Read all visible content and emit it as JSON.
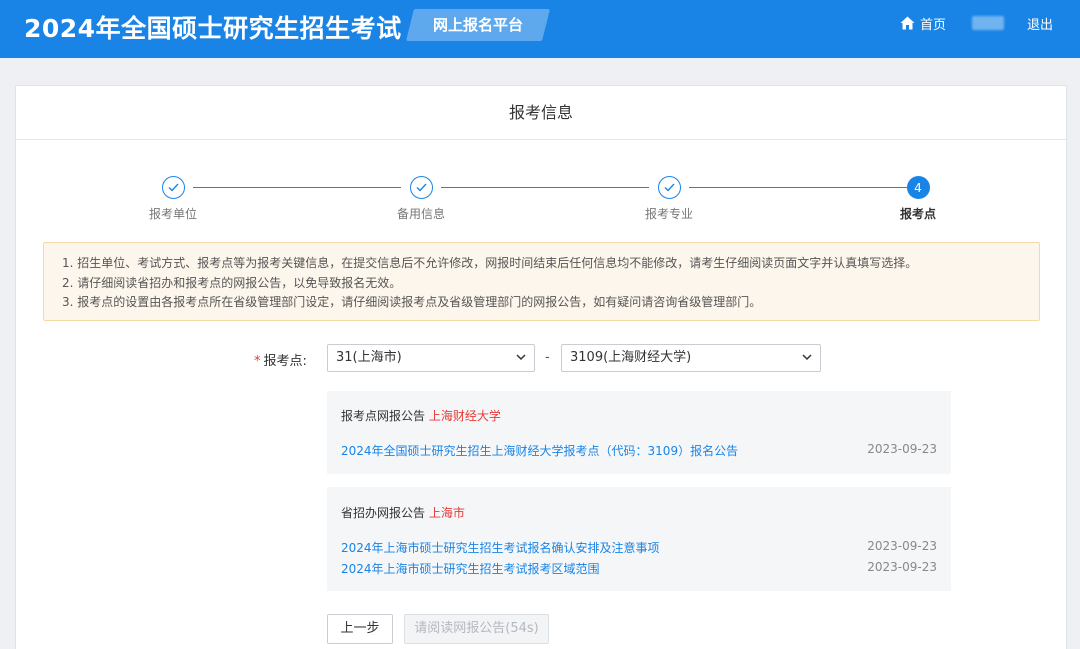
{
  "header": {
    "title": "2024年全国硕士研究生招生考试",
    "platform": "网上报名平台",
    "home_label": "首页",
    "logout_label": "退出"
  },
  "card": {
    "title": "报考信息"
  },
  "steps": [
    {
      "label": "报考单位",
      "status": "done"
    },
    {
      "label": "备用信息",
      "status": "done"
    },
    {
      "label": "报考专业",
      "status": "done"
    },
    {
      "label": "报考点",
      "status": "active",
      "number": "4"
    }
  ],
  "notice": [
    "1. 招生单位、考试方式、报考点等为报考关键信息，在提交信息后不允许修改，网报时间结束后任何信息均不能修改，请考生仔细阅读页面文字并认真填写选择。",
    "2. 请仔细阅读省招办和报考点的网报公告，以免导致报名无效。",
    "3. 报考点的设置由各报考点所在省级管理部门设定，请仔细阅读报考点及省级管理部门的网报公告，如有疑问请咨询省级管理部门。"
  ],
  "form": {
    "required_mark": "*",
    "label": "报考点:",
    "province_select": "31(上海市)",
    "separator": "-",
    "site_select": "3109(上海财经大学)"
  },
  "site_announcements": {
    "heading": "报考点网报公告",
    "heading_org": "上海财经大学",
    "items": [
      {
        "title": "2024年全国硕士研究生招生上海财经大学报考点（代码：3109）报名公告",
        "date": "2023-09-23"
      }
    ]
  },
  "province_announcements": {
    "heading": "省招办网报公告",
    "heading_org": "上海市",
    "items": [
      {
        "title": "2024年上海市硕士研究生招生考试报名确认安排及注意事项",
        "date": "2023-09-23"
      },
      {
        "title": "2024年上海市硕士研究生招生考试报考区域范围",
        "date": "2023-09-23"
      }
    ]
  },
  "buttons": {
    "prev": "上一步",
    "read": "请阅读网报公告(54s)"
  },
  "colors": {
    "primary": "#1a84e6",
    "highlight_red": "#e53935",
    "notice_bg": "#fdf6ec"
  }
}
